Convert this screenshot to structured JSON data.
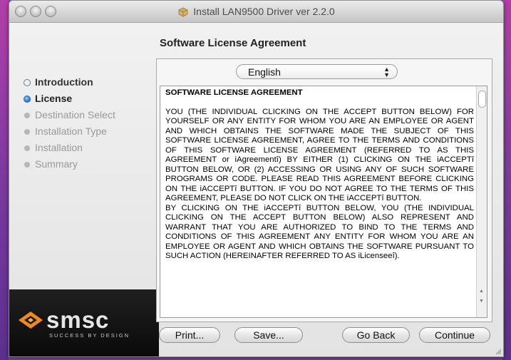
{
  "window": {
    "title": "Install LAN9500 Driver ver 2.2.0"
  },
  "sidebar": {
    "steps": [
      {
        "label": "Introduction",
        "state": "done"
      },
      {
        "label": "License",
        "state": "current"
      },
      {
        "label": "Destination Select",
        "state": "todo"
      },
      {
        "label": "Installation Type",
        "state": "todo"
      },
      {
        "label": "Installation",
        "state": "todo"
      },
      {
        "label": "Summary",
        "state": "todo"
      }
    ],
    "brand": {
      "name": "smsc",
      "tagline": "SUCCESS BY DESIGN"
    }
  },
  "main": {
    "title": "Software License Agreement",
    "language": "English",
    "license": {
      "heading": "SOFTWARE LICENSE AGREEMENT",
      "para1": "YOU (THE INDIVIDUAL CLICKING ON THE ACCEPT BUTTON BELOW) FOR YOURSELF OR ANY ENTITY FOR WHOM YOU ARE AN EMPLOYEE OR AGENT AND WHICH OBTAINS THE SOFTWARE MADE THE SUBJECT OF THIS SOFTWARE LICENSE AGREEMENT, AGREE TO THE TERMS AND CONDITIONS OF THIS SOFTWARE LICENSE AGREEMENT (REFERRED TO AS THIS AGREEMENT or iAgreementî) BY EITHER (1) CLICKING ON THE iACCEPTî BUTTON BELOW, OR (2) ACCESSING OR USING ANY OF SUCH SOFTWARE PROGRAMS OR CODE. PLEASE READ THIS AGREEMENT BEFORE CLICKING ON THE iACCEPTî BUTTON. IF YOU DO NOT AGREE TO THE TERMS OF THIS AGREEMENT, PLEASE DO NOT CLICK ON THE iACCEPTî BUTTON.",
      "para2": "BY CLICKING ON THE iACCEPTî BUTTON BELOW, YOU (THE INDIVIDUAL CLICKING ON THE ACCEPT BUTTON BELOW) ALSO REPRESENT AND WARRANT THAT YOU ARE AUTHORIZED TO BIND TO THE TERMS AND CONDITIONS OF THIS AGREEMENT ANY ENTITY FOR WHOM YOU ARE AN EMPLOYEE OR AGENT AND WHICH OBTAINS THE SOFTWARE PURSUANT TO SUCH ACTION (HEREINAFTER REFERRED TO AS iLicenseeî)."
    }
  },
  "buttons": {
    "print": "Print...",
    "save": "Save...",
    "go_back": "Go Back",
    "continue": "Continue"
  },
  "colors": {
    "accent": "#2d7fe0",
    "brand_orange": "#f08a1c"
  }
}
